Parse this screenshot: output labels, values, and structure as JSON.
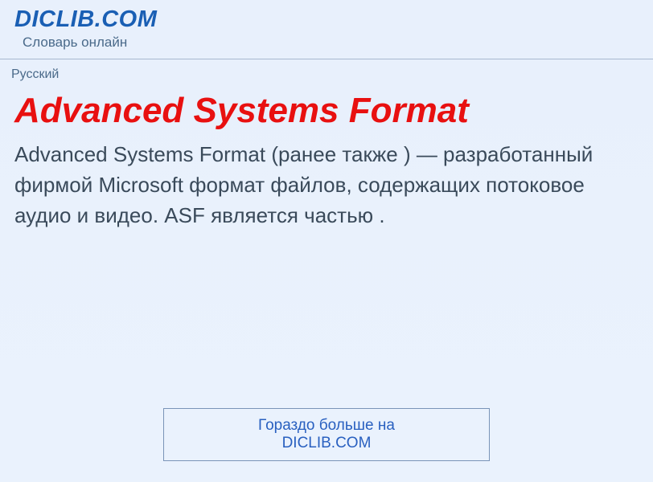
{
  "header": {
    "site_title": "DICLIB.COM",
    "site_subtitle": "Словарь онлайн"
  },
  "language_label": "Русский",
  "article": {
    "title": "Advanced Systems Format",
    "body": "Advanced Systems Format (ранее также ) — разработанный фирмой Microsoft формат файлов, содержащих потоковое аудио и видео. ASF является частью ."
  },
  "footer": {
    "cta_label": "Гораздо больше на DICLIB.COM"
  }
}
